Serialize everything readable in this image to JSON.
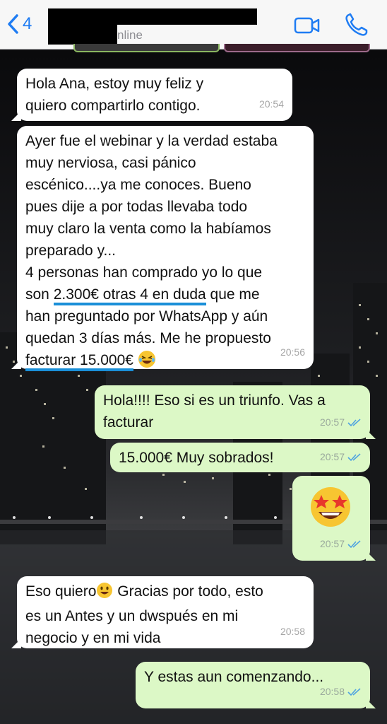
{
  "header": {
    "back_count": "4",
    "status": "nline"
  },
  "messages": [
    {
      "dir": "in",
      "text": "Hola Ana, estoy muy feliz y quiero compartirlo contigo.",
      "time": "20:54"
    },
    {
      "dir": "in",
      "line1": "Ayer fue el webinar y la verdad estaba",
      "line2": "muy nerviosa, casi pánico",
      "line3": "escénico....ya me conoces. Bueno",
      "line4": "pues dije a por todas llevaba todo",
      "line5": "muy claro la venta como la habíamos",
      "line6": "preparado y...",
      "line7": "4 personas han comprado yo lo que",
      "line8_a": "son ",
      "line8_u": "2.300€ otras 4 en duda",
      "line8_b": " que me",
      "line9": "han preguntado por WhatsApp y aún",
      "line10": "quedan 3 días más. Me he propuesto",
      "line11_u": "facturar 15.000€",
      "time": "20:56"
    },
    {
      "dir": "out",
      "line1": "Hola!!!! Eso si es un triunfo. Vas a",
      "line2": "facturar",
      "time": "20:57"
    },
    {
      "dir": "out",
      "text": "15.000€ Muy sobrados!",
      "time": "20:57"
    },
    {
      "dir": "out",
      "emoji": "star-struck-emoji",
      "time": "20:57"
    },
    {
      "dir": "in",
      "line1_a": "Eso quiero",
      "line1_b": " Gracias por todo, esto",
      "line2": "es un Antes y un dwspués en mi",
      "line3": "negocio y en mi vida",
      "time": "20:58"
    },
    {
      "dir": "out",
      "text": "Y estas aun comenzando...",
      "time": "20:58"
    }
  ],
  "colors": {
    "incoming_bubble": "#ffffff",
    "outgoing_bubble": "#dcf8c6",
    "accent_blue": "#1f7cf3",
    "underline": "#1a8fd8",
    "read_ticks": "#4fa3e0"
  },
  "icons": [
    "back-chevron-icon",
    "video-call-icon",
    "phone-call-icon",
    "double-check-icon",
    "laughing-emoji",
    "smiling-emoji",
    "star-struck-emoji"
  ]
}
